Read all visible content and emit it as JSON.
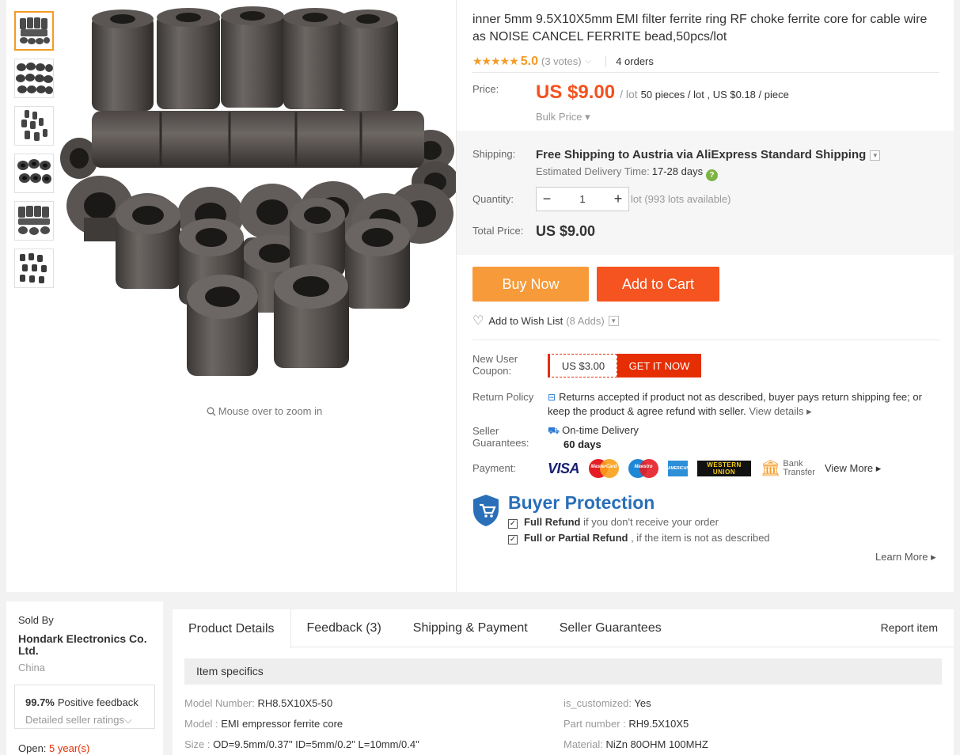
{
  "product": {
    "title": "inner 5mm 9.5X10X5mm EMI filter ferrite ring RF choke ferrite core for cable wire as NOISE CANCEL FERRITE bead,50pcs/lot",
    "stars": "★★★★★",
    "rating": "5.0",
    "votes": "(3 votes)",
    "orders": "4 orders",
    "zoom_hint": "Mouse over to zoom in"
  },
  "price": {
    "label": "Price:",
    "amount": "US $9.00",
    "unit": "/ lot",
    "detail": "50 pieces / lot , US $0.18 / piece",
    "bulk": "Bulk Price ▾"
  },
  "shipping": {
    "label": "Shipping:",
    "main": "Free Shipping to Austria via AliExpress Standard Shipping",
    "est_label": "Estimated Delivery Time:",
    "est_days": "17-28 days"
  },
  "quantity": {
    "label": "Quantity:",
    "minus": "−",
    "value": "1",
    "plus": "+",
    "note": "lot (993 lots available)"
  },
  "total": {
    "label": "Total Price:",
    "value": "US $9.00"
  },
  "actions": {
    "buy": "Buy Now",
    "cart": "Add to Cart",
    "wish": "Add to Wish List",
    "wish_adds": "(8 Adds)"
  },
  "coupon": {
    "label": "New User Coupon:",
    "amount": "US $3.00",
    "cta": "GET IT NOW"
  },
  "return_policy": {
    "label": "Return Policy",
    "text": "Returns accepted if product not as described, buyer pays return shipping fee; or keep the product & agree refund with seller.",
    "link": "View details ▸"
  },
  "guarantee": {
    "label": "Seller Guarantees:",
    "title": "On-time Delivery",
    "days": "60 days"
  },
  "payment": {
    "label": "Payment:",
    "visa": "VISA",
    "mastercard": "MasterCard",
    "maestro": "Maestro",
    "amex": "AMERICAN EXPRESS",
    "wu_line1": "WESTERN",
    "wu_line2": "UNION",
    "bank_line1": "Bank",
    "bank_line2": "Transfer",
    "more": "View More ▸"
  },
  "protection": {
    "title": "Buyer Protection",
    "line1_bold": "Full Refund",
    "line1_rest": " if you don't receive your order",
    "line2_bold": "Full or Partial Refund",
    "line2_rest": " , if the item is not as described",
    "learn_more": "Learn More ▸"
  },
  "seller": {
    "sold_by": "Sold By",
    "store_name": "Hondark Electronics Co. Ltd.",
    "country": "China",
    "feedback_pct": "99.7%",
    "feedback_label": "Positive feedback",
    "detailed": "Detailed seller ratings",
    "open_label": "Open:",
    "open_years": "5 year(s)"
  },
  "tabs": [
    "Product Details",
    "Feedback (3)",
    "Shipping & Payment",
    "Seller Guarantees"
  ],
  "report": "Report item",
  "specs": {
    "header": "Item specifics",
    "left": [
      {
        "k": "Model Number:",
        "v": "RH8.5X10X5-50"
      },
      {
        "k": "Model :",
        "v": "EMI empressor ferrite core"
      },
      {
        "k": "Size :",
        "v": "OD=9.5mm/0.37\" ID=5mm/0.2\" L=10mm/0.4\""
      }
    ],
    "right": [
      {
        "k": "is_customized:",
        "v": "Yes"
      },
      {
        "k": "Part number :",
        "v": "RH9.5X10X5"
      },
      {
        "k": "Material:",
        "v": "NiZn 80OHM 100MHZ"
      }
    ]
  },
  "colors": {
    "price_orange": "#f4511e",
    "buy_now": "#f79a3a",
    "add_to_cart": "#f5531f",
    "buyer_protection_blue": "#2a6fb7",
    "coupon_red": "#e62e04"
  },
  "icons": {
    "star": "star-icon",
    "help": "question-icon",
    "heart": "heart-icon",
    "shield": "shield-icon",
    "check": "checkbox-icon",
    "return": "return-icon",
    "truck": "truck-icon",
    "zoom": "magnifier-icon"
  }
}
